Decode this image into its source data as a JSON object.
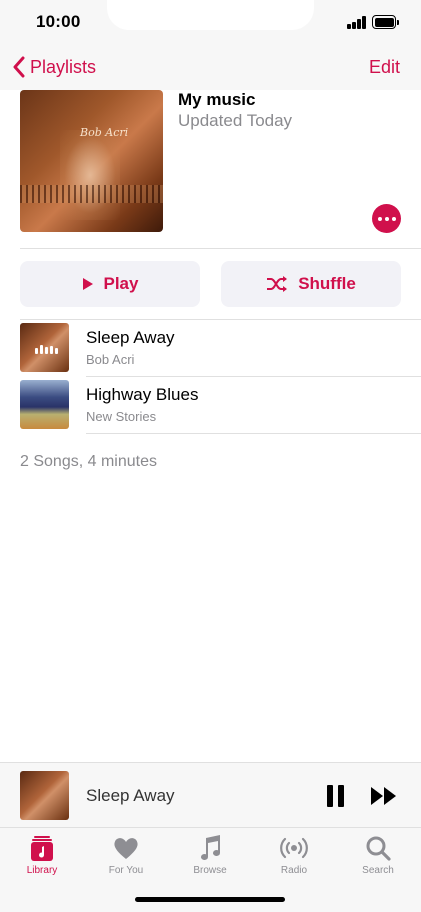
{
  "status_bar": {
    "time": "10:00"
  },
  "nav": {
    "back_label": "Playlists",
    "edit_label": "Edit"
  },
  "playlist": {
    "title": "My music",
    "subtitle": "Updated Today",
    "artwork_text": "Bob Acri"
  },
  "actions": {
    "play_label": "Play",
    "shuffle_label": "Shuffle"
  },
  "songs": [
    {
      "title": "Sleep Away",
      "artist": "Bob Acri",
      "playing": true
    },
    {
      "title": "Highway Blues",
      "artist": "New Stories",
      "playing": false
    }
  ],
  "summary": "2 Songs, 4 minutes",
  "now_playing": {
    "title": "Sleep Away"
  },
  "tabs": [
    {
      "label": "Library",
      "icon": "library-icon",
      "active": true
    },
    {
      "label": "For You",
      "icon": "heart-icon",
      "active": false
    },
    {
      "label": "Browse",
      "icon": "music-note-icon",
      "active": false
    },
    {
      "label": "Radio",
      "icon": "radio-icon",
      "active": false
    },
    {
      "label": "Search",
      "icon": "search-icon",
      "active": false
    }
  ],
  "colors": {
    "accent": "#d0104c",
    "secondary_text": "#8a8a8e",
    "bar_background": "#f7f7f7"
  }
}
